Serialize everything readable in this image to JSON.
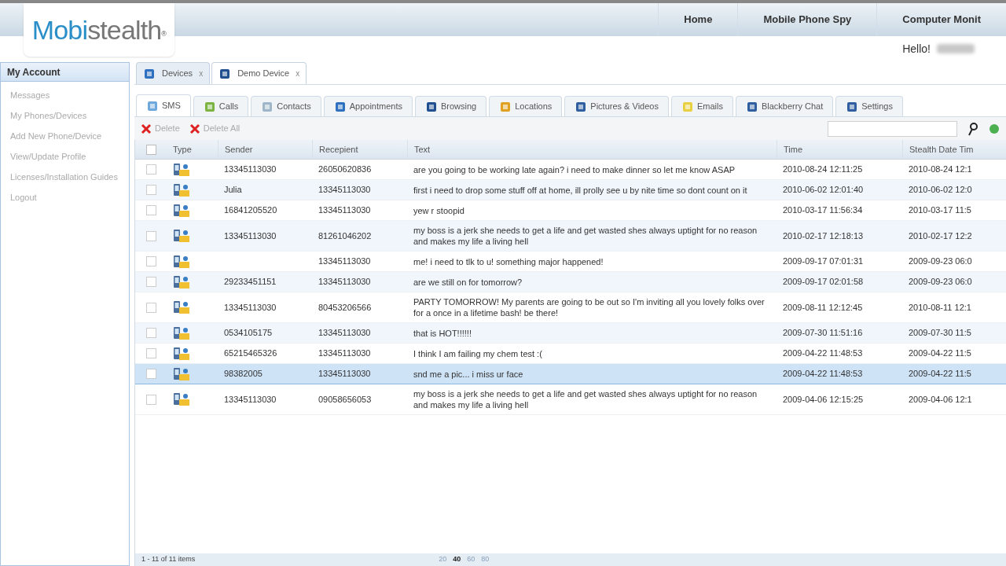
{
  "logo": {
    "first": "Mobi",
    "second": "stealth",
    "mark": "®"
  },
  "nav": [
    "Home",
    "Mobile Phone Spy",
    "Computer Monit"
  ],
  "greeting": "Hello!",
  "sidebar": {
    "title": "My Account",
    "items": [
      {
        "label": "Messages",
        "disabled": true
      },
      {
        "label": "My Phones/Devices",
        "disabled": true
      },
      {
        "label": "Add New Phone/Device",
        "disabled": true
      },
      {
        "label": "View/Update Profile",
        "disabled": true
      },
      {
        "label": "Licenses/Installation Guides",
        "disabled": true
      },
      {
        "label": "Logout",
        "disabled": true
      }
    ]
  },
  "device_tabs": [
    {
      "label": "Devices",
      "close": "x",
      "selected": false
    },
    {
      "label": "Demo Device",
      "close": "x",
      "selected": true
    }
  ],
  "tabs": [
    {
      "label": "SMS",
      "selected": true
    },
    {
      "label": "Calls",
      "selected": false
    },
    {
      "label": "Contacts",
      "selected": false
    },
    {
      "label": "Appointments",
      "selected": false
    },
    {
      "label": "Browsing",
      "selected": false
    },
    {
      "label": "Locations",
      "selected": false
    },
    {
      "label": "Pictures & Videos",
      "selected": false
    },
    {
      "label": "Emails",
      "selected": false
    },
    {
      "label": "Blackberry Chat",
      "selected": false
    },
    {
      "label": "Settings",
      "selected": false
    }
  ],
  "toolbar": [
    {
      "label": "Delete",
      "disabled": true
    },
    {
      "label": "Delete All",
      "disabled": true
    }
  ],
  "table": {
    "all_checked": false,
    "columns": [
      "Type",
      "Sender",
      "Recepient",
      "Text",
      "Time",
      "Stealth Date Tim"
    ],
    "rows": [
      {
        "sender": "13345113030",
        "recipient": "26050620836",
        "text": "are you going to be working late again? i need to make dinner so let me know ASAP",
        "time": "2010-08-24 12:11:25",
        "stealth": "2010-08-24 12:1",
        "selected": false
      },
      {
        "sender": "Julia",
        "recipient": "13345113030",
        "text": "first i need to drop some stuff off at home, ill prolly see u by nite time so dont count on it",
        "time": "2010-06-02 12:01:40",
        "stealth": "2010-06-02 12:0",
        "selected": false
      },
      {
        "sender": "16841205520",
        "recipient": "13345113030",
        "text": "yew r stoopid",
        "time": "2010-03-17 11:56:34",
        "stealth": "2010-03-17 11:5",
        "selected": false
      },
      {
        "sender": "13345113030",
        "recipient": "81261046202",
        "text": "my boss is a jerk she needs to get a life and get wasted shes always uptight for no reason and makes my life a living hell",
        "time": "2010-02-17 12:18:13",
        "stealth": "2010-02-17 12:2",
        "selected": false
      },
      {
        "recipient": "13345113030",
        "text": "me! i need to tlk to u! something major happened!",
        "time": "2009-09-17 07:01:31",
        "stealth": "2009-09-23 06:0",
        "selected": false
      },
      {
        "sender": "29233451151",
        "recipient": "13345113030",
        "text": "are we still on for tomorrow?",
        "time": "2009-09-17 02:01:58",
        "stealth": "2009-09-23 06:0",
        "selected": false
      },
      {
        "sender": "13345113030",
        "recipient": "80453206566",
        "text": "PARTY TOMORROW! My parents are going to be out so I'm inviting all you lovely folks over for a once in a lifetime bash! be there!",
        "time": "2009-08-11 12:12:45",
        "stealth": "2010-08-11 12:1",
        "selected": false
      },
      {
        "sender": "0534105175",
        "recipient": "13345113030",
        "text": "that is HOT!!!!!!",
        "time": "2009-07-30 11:51:16",
        "stealth": "2009-07-30 11:5",
        "selected": false
      },
      {
        "sender": "65215465326",
        "recipient": "13345113030",
        "text": "I think I am failing my chem test :(",
        "time": "2009-04-22 11:48:53",
        "stealth": "2009-04-22 11:5",
        "selected": false
      },
      {
        "sender": "98382005",
        "recipient": "13345113030",
        "text": "snd me a pic... i miss ur face",
        "time": "2009-04-22 11:48:53",
        "stealth": "2009-04-22 11:5",
        "selected": true
      },
      {
        "sender": "13345113030",
        "recipient": "09058656053",
        "text": "my boss is a jerk she needs to get a life and get wasted shes always uptight for no reason and makes my life a living hell",
        "time": "2009-04-06 12:15:25",
        "stealth": "2009-04-06 12:1",
        "selected": false
      }
    ]
  },
  "status": "1 - 11 of 11 items",
  "page_sizes": [
    {
      "label": "20",
      "selected": false
    },
    {
      "label": "40",
      "selected": true
    },
    {
      "label": "60",
      "selected": false
    },
    {
      "label": "80",
      "selected": false
    }
  ]
}
